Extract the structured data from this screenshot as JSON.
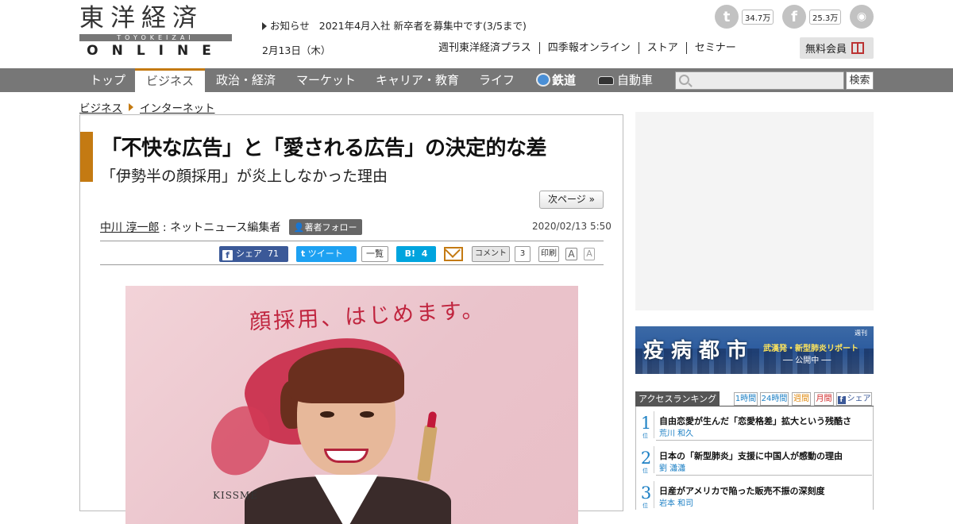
{
  "logo": {
    "kanji": "東洋経済",
    "roman": "TOYOKEIZAI",
    "online": "ONLINE"
  },
  "notice": {
    "label": "お知らせ",
    "text": "2021年4月入社 新卒者を募集中です(3/5まで)"
  },
  "date": "2月13日（木）",
  "social": {
    "twitter_count": "34.7万",
    "facebook_count": "25.3万"
  },
  "subnav": [
    "週刊東洋経済プラス",
    "四季報オンライン",
    "ストア",
    "セミナー"
  ],
  "free_member": "無料会員",
  "mainnav": [
    "トップ",
    "ビジネス",
    "政治・経済",
    "マーケット",
    "キャリア・教育",
    "ライフ",
    "鉄道",
    "自動車"
  ],
  "search": {
    "button": "検索",
    "placeholder": ""
  },
  "breadcrumb": [
    "ビジネス",
    "インターネット"
  ],
  "article": {
    "title": "「不快な広告」と「愛される広告」の決定的な差",
    "subtitle": "「伊勢半の顔採用」が炎上しなかった理由",
    "next_page": "次ページ »",
    "author": "中川 淳一郎",
    "author_role": " : ネットニュース編集者",
    "follow": "著者フォロー",
    "pubdate": "2020/02/13 5:50",
    "share": {
      "fb_label": "シェア",
      "fb_count": "71",
      "tweet": "ツイート",
      "list": "一覧",
      "hatena_count": "4",
      "comment": "コメント",
      "comment_count": "3",
      "print": "印刷",
      "font_large": "A",
      "font_small": "A"
    },
    "hero": {
      "caption": "顔採用、はじめます。",
      "brand": "KISSME"
    }
  },
  "banner": {
    "big": "疫病都市",
    "line1": "武漢発・新型肺炎リポート",
    "line2": "── 公開中 ──",
    "publisher": "週刊"
  },
  "ranking": {
    "label": "アクセスランキング",
    "tabs": [
      "1時間",
      "24時間",
      "週間",
      "月間",
      "シェア"
    ],
    "items": [
      {
        "num": "1",
        "title": "自由恋愛が生んだ「恋愛格差」拡大という残酷さ",
        "author": "荒川 和久"
      },
      {
        "num": "2",
        "title": "日本の「新型肺炎」支援に中国人が感動の理由",
        "author": "劉 瀟瀟"
      },
      {
        "num": "3",
        "title": "日産がアメリカで陥った販売不振の深刻度",
        "author": "岩本 和司"
      }
    ],
    "rank_suffix": "位"
  },
  "colors": {
    "accent": "#c47a12",
    "nav_bg": "#777777",
    "link_blue": "#1b7fc4",
    "facebook": "#3b5998",
    "twitter": "#1da1f2",
    "hatena": "#00a4de"
  },
  "icons": [
    "twitter-icon",
    "facebook-icon",
    "rss-icon",
    "gift-icon",
    "railway-icon",
    "car-icon",
    "search-icon",
    "mail-icon",
    "follow-icon"
  ]
}
